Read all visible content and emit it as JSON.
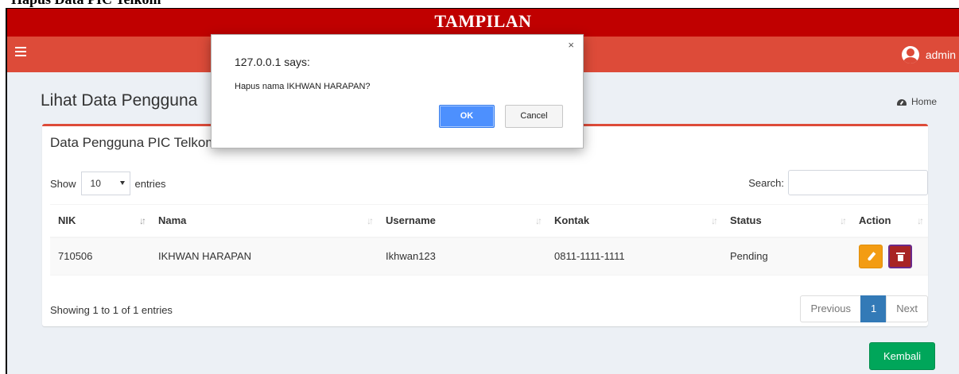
{
  "document": {
    "heading_fragment": "Hapus Data PIC Telkom"
  },
  "caption": "TAMPILAN",
  "navbar": {
    "menu_icon": "hamburger-icon",
    "user_icon": "user-avatar-icon",
    "username": "admin",
    "color": "#dd4b39"
  },
  "page": {
    "title": "Lihat Data Pengguna",
    "breadcrumb_icon": "dashboard-icon",
    "breadcrumb": "Home"
  },
  "box": {
    "title": "Data Pengguna PIC Telkom",
    "show_label": "Show",
    "page_length": "10",
    "entries_label": "entries",
    "search_label": "Search:",
    "search_value": ""
  },
  "table": {
    "columns": [
      "NIK",
      "Nama",
      "Username",
      "Kontak",
      "Status",
      "Action"
    ],
    "rows": [
      {
        "nik": "710506",
        "nama": "IKHWAN HARAPAN",
        "username": "Ikhwan123",
        "kontak": "0811-1111-1111",
        "status": "Pending",
        "edit_icon": "pencil-icon",
        "delete_icon": "trash-icon"
      }
    ]
  },
  "footer": {
    "info": "Showing 1 to 1 of 1 entries",
    "prev": "Previous",
    "page": "1",
    "next": "Next"
  },
  "back_button": "Kembali",
  "dialog": {
    "title": "127.0.0.1 says:",
    "message": "Hapus nama IKHWAN HARAPAN?",
    "ok": "OK",
    "cancel": "Cancel",
    "close": "×"
  },
  "colors": {
    "caption_bg": "#c00000",
    "accent": "#dd4b39",
    "edit": "#f39c12",
    "delete": "#a82424",
    "back": "#00a65a",
    "pager_active": "#337ab7"
  }
}
